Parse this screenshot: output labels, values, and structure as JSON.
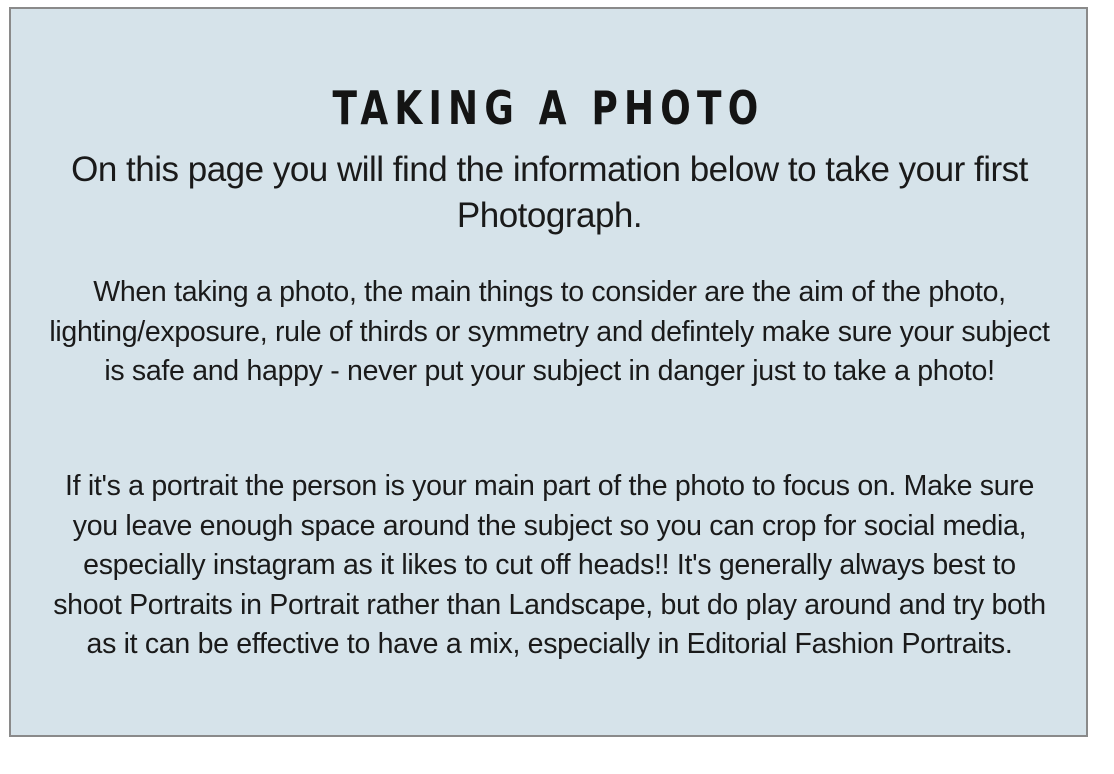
{
  "page": {
    "title": "TAKING A PHOTO",
    "subtitle": "On this page you will find the information below to take your first Photograph.",
    "paragraphs": [
      "When taking a photo, the main things to consider are the aim of the photo, lighting/exposure, rule of thirds or symmetry and defintely make sure your subject is safe and happy - never put your subject in danger just to take a photo!",
      "If it's a portrait the person is your main part of the photo to focus on. Make sure you leave enough space around the subject so you can crop for social media, especially instagram as it likes to cut off heads!! It's generally always best to shoot Portraits in Portrait rather than Landscape, but do play around and try both as it can be effective to have a mix, especially in Editorial Fashion Portraits."
    ]
  },
  "colors": {
    "card_background": "#d6e3ea",
    "card_border": "#8a8a8a",
    "text": "#1a1a1a"
  }
}
